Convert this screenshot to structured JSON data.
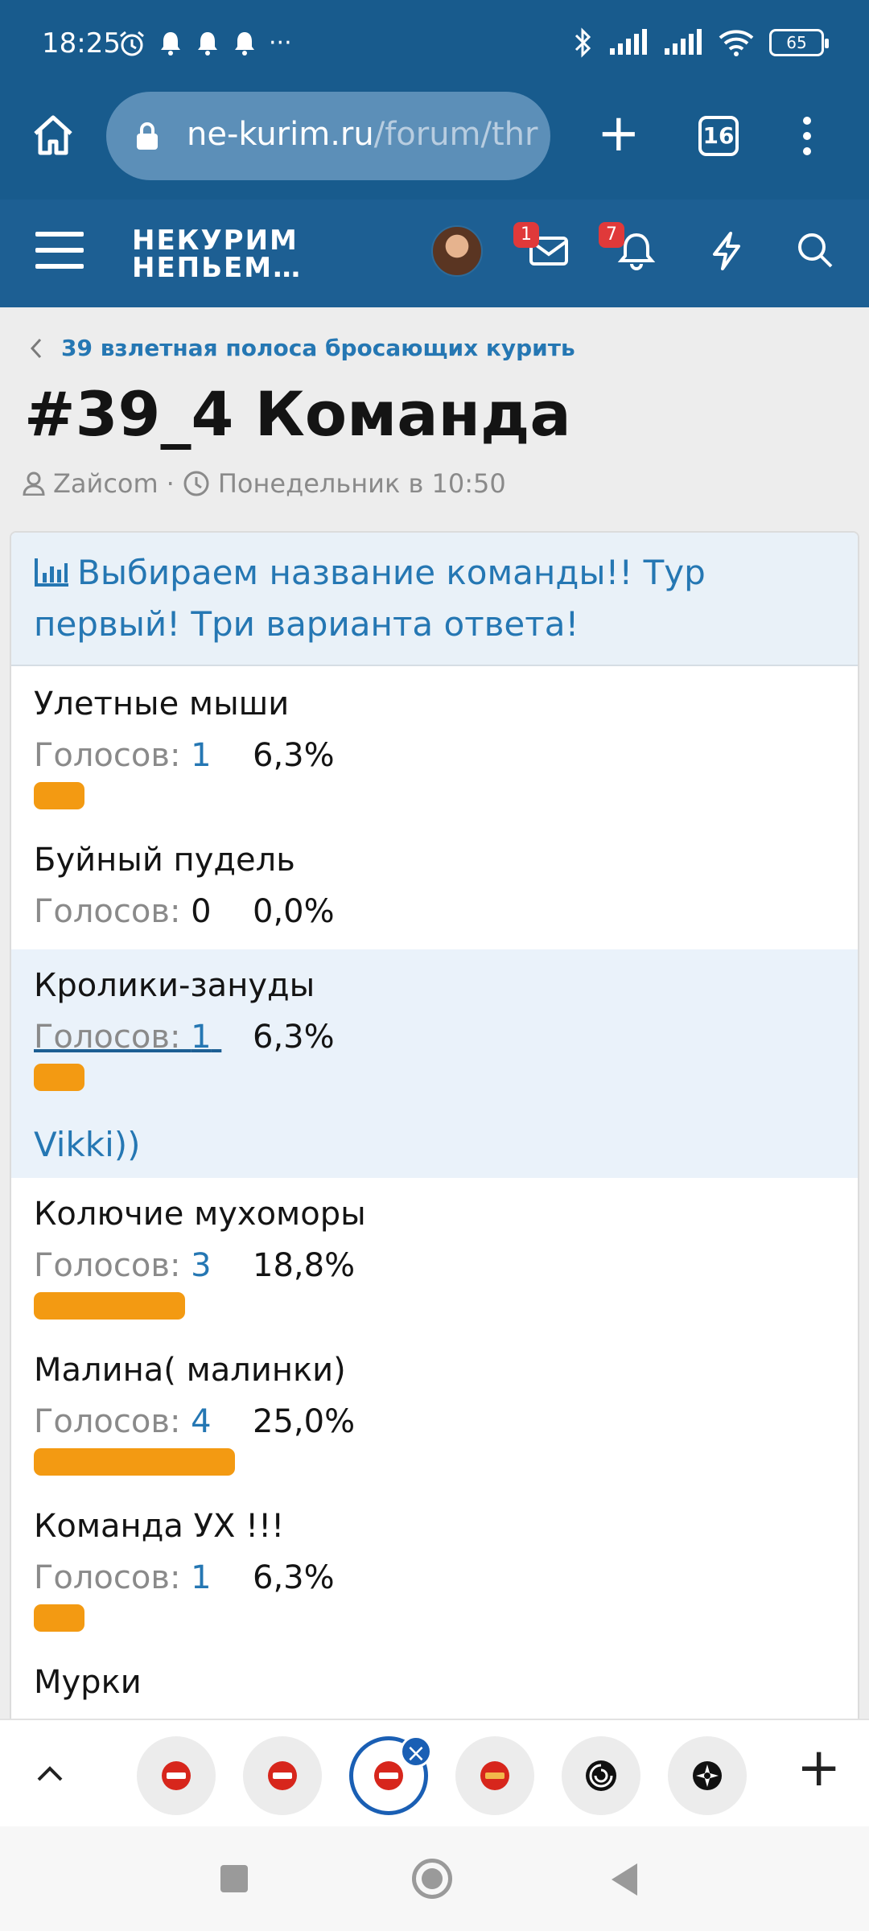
{
  "status_bar": {
    "time": "18:25",
    "dots": "···",
    "battery": "65",
    "icons": [
      "alarm-icon",
      "bell-icon",
      "bell-icon",
      "bell-icon",
      "bluetooth-icon",
      "signal-icon",
      "signal-icon",
      "wifi-icon",
      "battery-icon"
    ]
  },
  "browser": {
    "url_host": "ne-kurim.ru",
    "url_path": "/forum/thr",
    "tab_count": "16",
    "new_tab_label": "+"
  },
  "site_header": {
    "logo_line1": "НЕКУРИМ",
    "logo_line2": "НЕПЬЕМ…",
    "messages_badge": "1",
    "alerts_badge": "7"
  },
  "breadcrumb": {
    "label": "39 взлетная полоса бросающих курить"
  },
  "thread": {
    "title": "#39_4 Команда",
    "author": "Zaйcom",
    "separator": "·",
    "date": "Понедельник в 10:50"
  },
  "poll": {
    "question": "Выбираем название команды!! Тур первый! Три варианта ответа!",
    "votes_label": "Голосов: ",
    "options": [
      {
        "name": "Улетные мыши",
        "votes": "1",
        "percent": "6,3%",
        "fraction": 0.063
      },
      {
        "name": "Буйный пудель",
        "votes": "0",
        "percent": "0,0%",
        "fraction": 0.0
      },
      {
        "name": "Кролики-зануды",
        "votes": "1",
        "percent": "6,3%",
        "fraction": 0.063,
        "voter": "Vikki))"
      },
      {
        "name": "Колючие мухоморы",
        "votes": "3",
        "percent": "18,8%",
        "fraction": 0.188
      },
      {
        "name": "Малина( малинки)",
        "votes": "4",
        "percent": "25,0%",
        "fraction": 0.25
      },
      {
        "name": "Команда УХ !!!",
        "votes": "1",
        "percent": "6,3%",
        "fraction": 0.063
      },
      {
        "name": "Мурки"
      }
    ]
  },
  "colors": {
    "header_blue": "#185b8d",
    "link_blue": "#2577b3",
    "bar_orange": "#f39a12",
    "highlight": "#eaf2fa"
  }
}
